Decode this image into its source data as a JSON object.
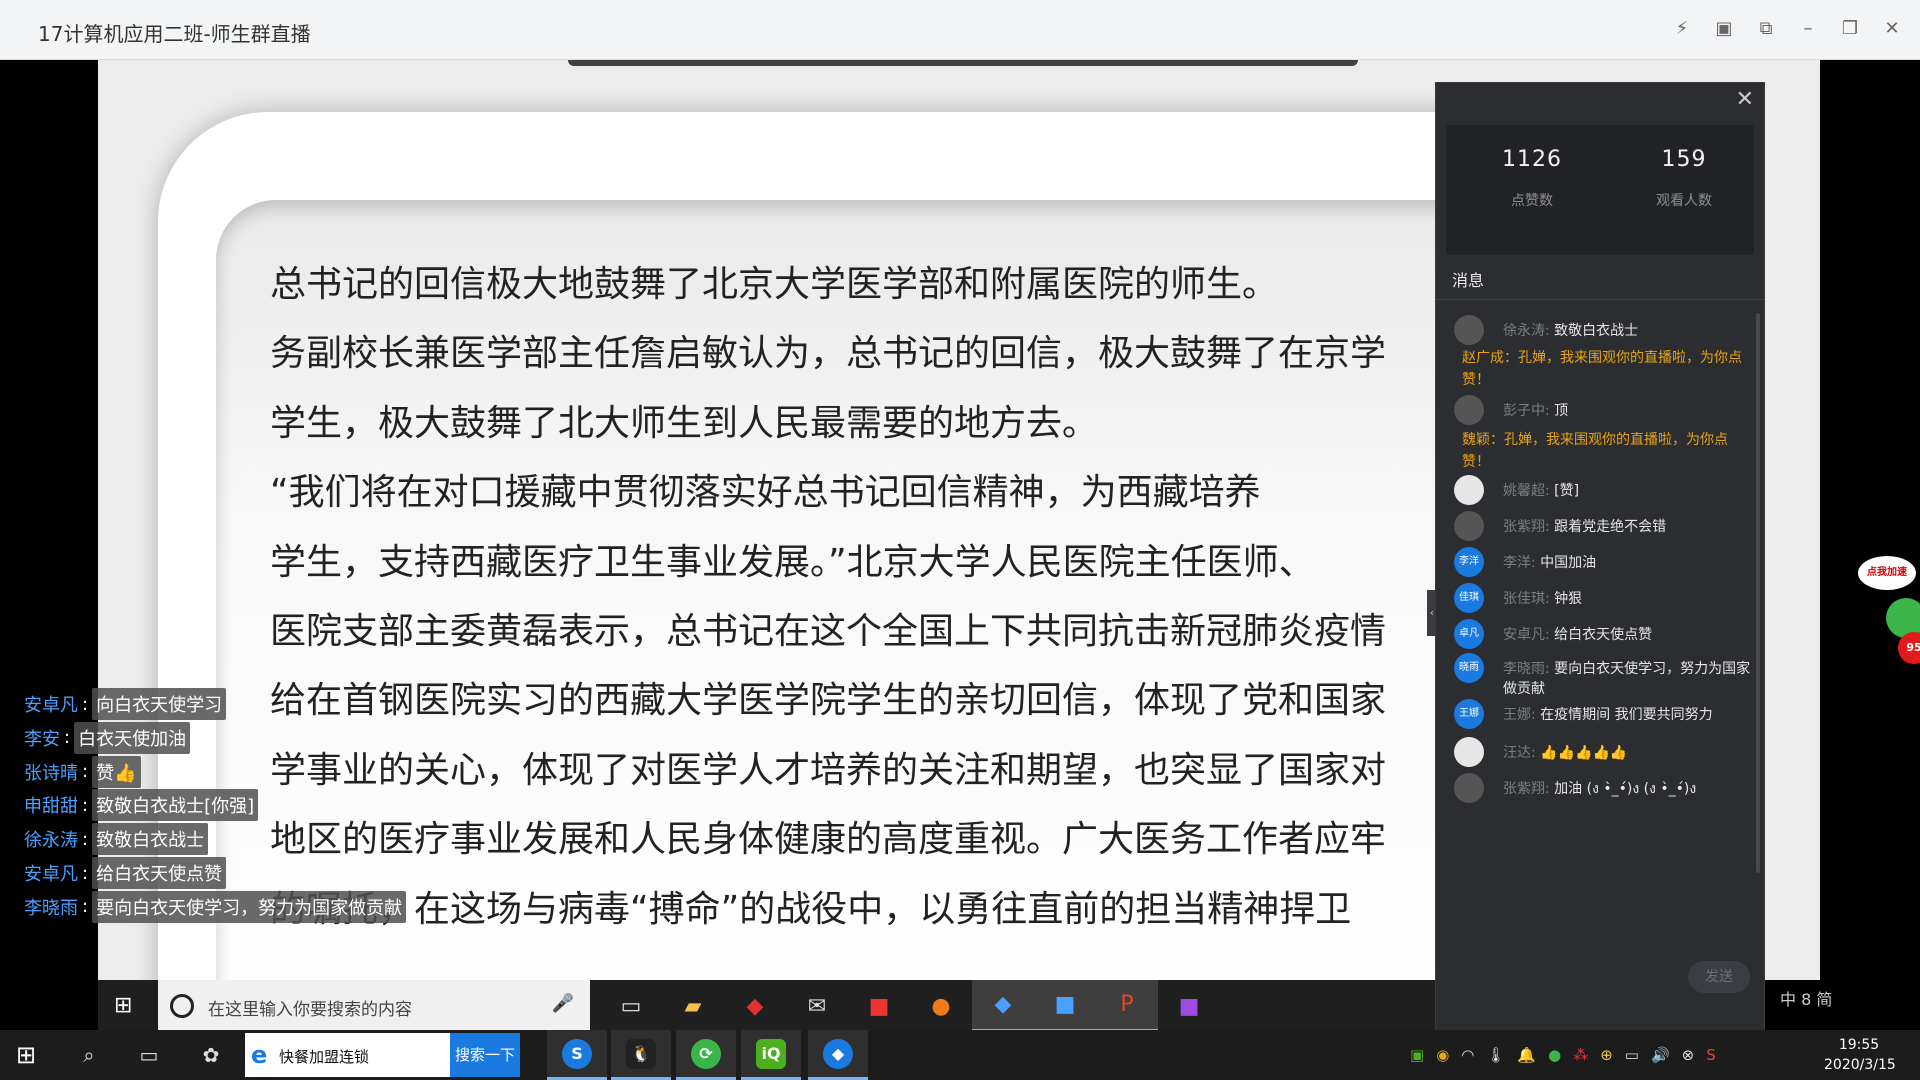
{
  "window": {
    "title": "17计算机应用二班-师生群直播"
  },
  "slide": {
    "lines": [
      "    总书记的回信极大地鼓舞了北京大学医学部和附属医院的师生。",
      "务副校长兼医学部主任詹启敏认为，总书记的回信，极大鼓舞了在京学",
      "学生，极大鼓舞了北大师生到人民最需要的地方去。",
      "    “我们将在对口援藏中贯彻落实好总书记回信精神，为西藏培养",
      "学生，支持西藏医疗卫生事业发展。”北京大学人民医院主任医师、",
      "医院支部主委黄磊表示，总书记在这个全国上下共同抗击新冠肺炎疫情",
      "给在首钢医院实习的西藏大学医学院学生的亲切回信，体现了党和国家",
      "学事业的关心，体现了对医学人才培养的关注和期望，也突显了国家对",
      "地区的医疗事业发展和人民身体健康的高度重视。广大医务工作者应牢",
      "的嘱托，在这场与病毒“搏命”的战役中，以勇往直前的担当精神捍卫"
    ]
  },
  "danmaku": [
    {
      "name": "安卓凡",
      "msg": "向白衣天使学习"
    },
    {
      "name": "李安",
      "msg": "白衣天使加油"
    },
    {
      "name": "张诗晴",
      "msg": "赞👍"
    },
    {
      "name": "申甜甜",
      "msg": "致敬白衣战士[你强]"
    },
    {
      "name": "徐永涛",
      "msg": "致敬白衣战士"
    },
    {
      "name": "安卓凡",
      "msg": "给白衣天使点赞"
    },
    {
      "name": "李晓雨",
      "msg": "要向白衣天使学习，努力为国家做贡献"
    }
  ],
  "panel": {
    "likes": "1126",
    "likes_label": "点赞数",
    "viewers": "159",
    "viewers_label": "观看人数",
    "messages_title": "消息",
    "send_label": "发送",
    "messages": [
      {
        "type": "user",
        "name": "徐永涛:",
        "text": "致敬白衣战士",
        "avatar": ""
      },
      {
        "type": "system",
        "text": "赵广成：孔婵，我来围观你的直播啦，为你点赞！"
      },
      {
        "type": "user",
        "name": "彭子中:",
        "text": "顶",
        "avatar": ""
      },
      {
        "type": "system",
        "text": "魏颖：孔婵，我来围观你的直播啦，为你点赞！"
      },
      {
        "type": "user",
        "name": "姚馨超:",
        "text": "[赞]",
        "avatar": ""
      },
      {
        "type": "user",
        "name": "张紫翔:",
        "text": "跟着党走绝不会错",
        "avatar": ""
      },
      {
        "type": "user",
        "name": "李洋:",
        "text": "中国加油",
        "avatar": "李洋"
      },
      {
        "type": "user",
        "name": "张佳琪:",
        "text": "钟狠",
        "avatar": "佳琪"
      },
      {
        "type": "user",
        "name": "安卓凡:",
        "text": "给白衣天使点赞",
        "avatar": "卓凡"
      },
      {
        "type": "user",
        "name": "李晓雨:",
        "text": "要向白衣天使学习，努力为国家做贡献",
        "avatar": "晓雨"
      },
      {
        "type": "user",
        "name": "王娜:",
        "text": "在疫情期间 我们要共同努力",
        "avatar": "王娜"
      },
      {
        "type": "user",
        "name": "汪达:",
        "text": "👍👍👍👍👍",
        "avatar": ""
      },
      {
        "type": "user",
        "name": "张紫翔:",
        "text": "加油 (ง •̀_•́)ง (ง •̀_•́)ง",
        "avatar": ""
      }
    ]
  },
  "floater": {
    "bubble": "点我加速",
    "badge": "95"
  },
  "inner_taskbar": {
    "search_placeholder": "在这里输入你要搜索的内容",
    "ime": "中 8 简"
  },
  "taskbar": {
    "search_text": "快餐加盟连锁",
    "search_button": "搜索一下",
    "time": "19:55",
    "date": "2020/3/15"
  },
  "colors": {
    "accent": "#1a7ae0",
    "danmaku_name": "#4aa0ff",
    "system_msg": "#e8a316",
    "panel_bg": "#2b2d31"
  }
}
